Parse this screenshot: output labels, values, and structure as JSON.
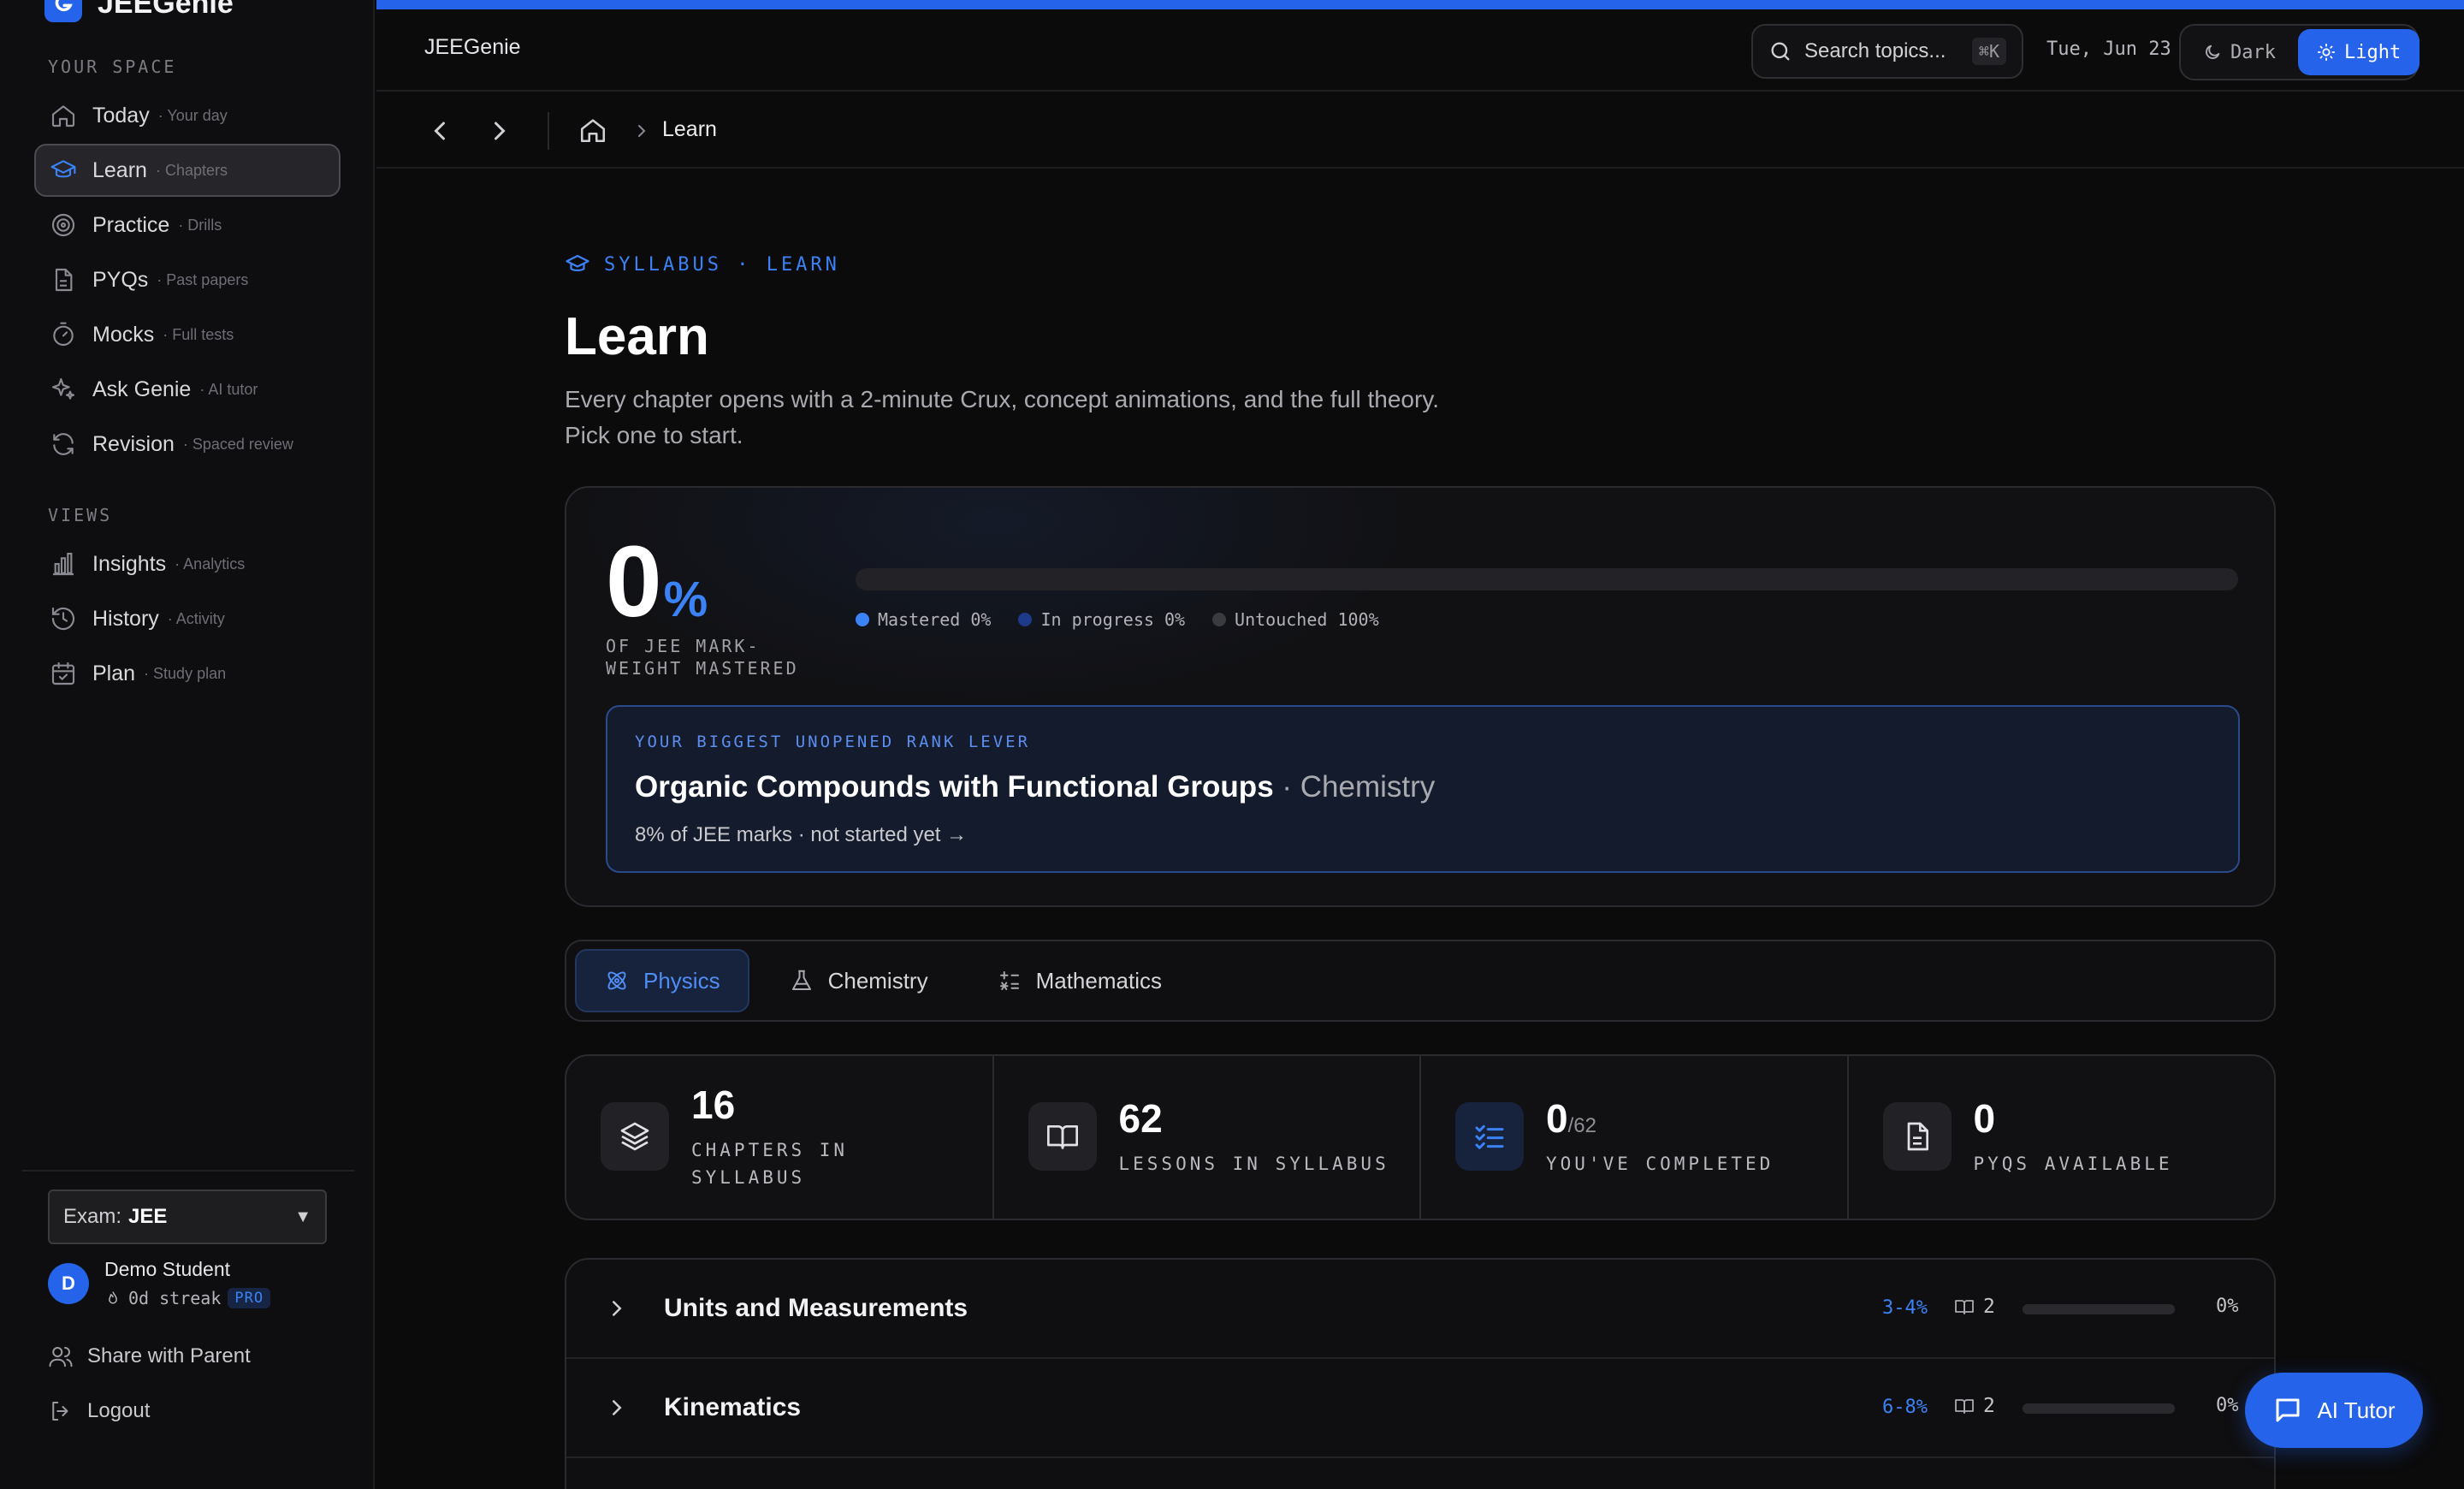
{
  "brand": {
    "name": "JEEGenie"
  },
  "sidebar": {
    "section_space": "YOUR SPACE",
    "space_items": [
      {
        "label": "Today",
        "sub": "· Your day",
        "icon": "home-icon"
      },
      {
        "label": "Learn",
        "sub": "· Chapters",
        "icon": "graduation-cap-icon",
        "active": true
      },
      {
        "label": "Practice",
        "sub": "· Drills",
        "icon": "target-icon"
      },
      {
        "label": "PYQs",
        "sub": "· Past papers",
        "icon": "document-icon"
      },
      {
        "label": "Mocks",
        "sub": "· Full tests",
        "icon": "timer-icon"
      },
      {
        "label": "Ask Genie",
        "sub": "· AI tutor",
        "icon": "sparkles-icon"
      },
      {
        "label": "Revision",
        "sub": "· Spaced review",
        "icon": "refresh-icon"
      }
    ],
    "section_views": "VIEWS",
    "view_items": [
      {
        "label": "Insights",
        "sub": "· Analytics",
        "icon": "bar-chart-icon"
      },
      {
        "label": "History",
        "sub": "· Activity",
        "icon": "history-icon"
      },
      {
        "label": "Plan",
        "sub": "· Study plan",
        "icon": "calendar-icon"
      }
    ],
    "exam": {
      "prefix": "Exam:",
      "value": "JEE"
    },
    "user": {
      "initial": "D",
      "name": "Demo Student",
      "streak": "0d streak",
      "badge": "PRO"
    },
    "share_label": "Share with Parent",
    "logout_label": "Logout"
  },
  "topbar": {
    "title": "JEEGenie",
    "search_placeholder": "Search topics...",
    "search_shortcut": "⌘K",
    "date": "Tue, Jun 23",
    "theme_dark": "Dark",
    "theme_light": "Light",
    "theme_selected": "Light"
  },
  "breadcrumb": {
    "current": "Learn"
  },
  "main": {
    "eyebrow": "SYLLABUS · LEARN",
    "title": "Learn",
    "description": "Every chapter opens with a 2-minute Crux, concept animations, and the full theory. Pick one to start.",
    "mastery": {
      "value": "0",
      "symbol": "%",
      "fraction": 0,
      "caption": "OF JEE MARK-WEIGHT MASTERED",
      "legend": [
        {
          "label": "Mastered 0%",
          "color": "#3b82f6"
        },
        {
          "label": "In progress 0%",
          "color": "#1e3a8a"
        },
        {
          "label": "Untouched 100%",
          "color": "#3a3a3f"
        }
      ]
    },
    "lever": {
      "eyebrow": "YOUR BIGGEST UNOPENED RANK LEVER",
      "chapter": "Organic Compounds with Functional Groups",
      "subject": "· Chemistry",
      "meta": "8% of JEE marks · not started yet →"
    },
    "subjects": [
      {
        "label": "Physics",
        "icon": "atom-icon",
        "active": true
      },
      {
        "label": "Chemistry",
        "icon": "flask-icon"
      },
      {
        "label": "Mathematics",
        "icon": "calculator-icon"
      }
    ],
    "stats": [
      {
        "value": "16",
        "of": "",
        "label": "CHAPTERS IN SYLLABUS",
        "icon": "layers-icon"
      },
      {
        "value": "62",
        "of": "",
        "label": "LESSONS IN SYLLABUS",
        "icon": "book-icon"
      },
      {
        "value": "0",
        "of": "/62",
        "label": "YOU'VE COMPLETED",
        "icon": "checklist-icon"
      },
      {
        "value": "0",
        "of": "",
        "label": "PYQS AVAILABLE",
        "icon": "file-icon"
      }
    ],
    "chapters": [
      {
        "name": "Units and Measurements",
        "weight": "3-4%",
        "lessons": "2",
        "progress": 0,
        "pct": "0%"
      },
      {
        "name": "Kinematics",
        "weight": "6-8%",
        "lessons": "2",
        "progress": 0,
        "pct": "0%"
      }
    ]
  },
  "ai_tutor": {
    "label": "AI Tutor"
  }
}
